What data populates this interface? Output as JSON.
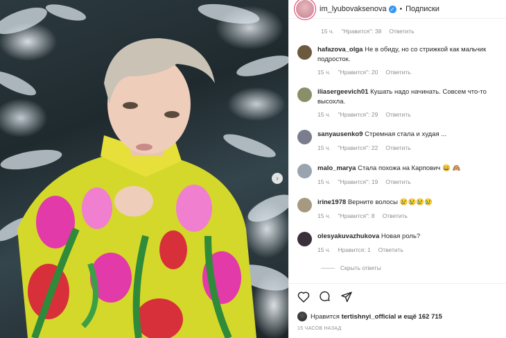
{
  "post": {
    "username": "im_lyubovaksenova",
    "verified_icon": "verified-badge-icon",
    "separator": "•",
    "follow_label": "Подписки"
  },
  "top_comment_meta": {
    "time": "15 ч.",
    "likes": "\"Нравится\": 38",
    "reply": "Ответить"
  },
  "comments": [
    {
      "user": "hafazova_olga",
      "text": "Не в обиду, но со стрижкой как мальчик подросток.",
      "time": "15 ч.",
      "likes": "\"Нравится\": 20",
      "reply": "Ответить",
      "avatar_color": "#6b5a3e"
    },
    {
      "user": "iliasergeevich01",
      "text": "Кушать надо начинать. Совсем что-то высохла.",
      "time": "15 ч.",
      "likes": "\"Нравится\": 29",
      "reply": "Ответить",
      "avatar_color": "#8a8f6a"
    },
    {
      "user": "sanyausenko9",
      "text": "Стремная стала и худая ...",
      "time": "15 ч.",
      "likes": "\"Нравится\": 22",
      "reply": "Ответить",
      "avatar_color": "#7a7d8c"
    },
    {
      "user": "malo_marya",
      "text": "Стала похожа на Карпович 😄 🙈",
      "time": "15 ч.",
      "likes": "\"Нравится\": 19",
      "reply": "Ответить",
      "avatar_color": "#9aa4b0"
    },
    {
      "user": "irine1978",
      "text": "Верните волосы 😢😢😢😢",
      "time": "15 ч.",
      "likes": "\"Нравится\": 8",
      "reply": "Ответить",
      "avatar_color": "#a59a80"
    },
    {
      "user": "olesyakuvazhukova",
      "text": "Новая роль?",
      "time": "15 ч.",
      "likes": "Нравится: 1",
      "reply": "Ответить",
      "avatar_color": "#3b2f3a"
    }
  ],
  "replies_toggle": "Скрыть ответы",
  "likes_line": {
    "prefix": "Нравится",
    "user": "tertishnyi_official",
    "suffix": "и ещё 162 715"
  },
  "timestamp": "15 ЧАСОВ НАЗАД",
  "icons": {
    "like": "heart-icon",
    "comment": "comment-icon",
    "share": "share-icon",
    "carousel": "chevron-right-icon"
  }
}
